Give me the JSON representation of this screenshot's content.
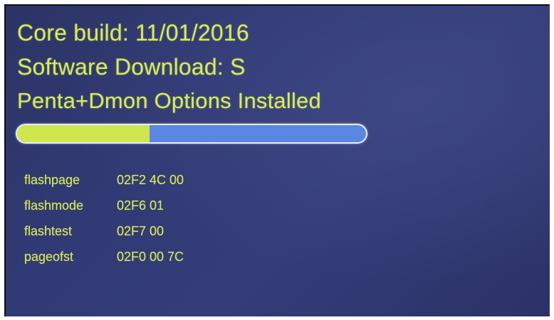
{
  "status": {
    "core_build": "Core build: 11/01/2016",
    "software_download": "Software Download: S",
    "options_installed": "Penta+Dmon Options Installed"
  },
  "progress": {
    "fraction": 0.38,
    "fill_color": "#cfe64c",
    "track_color": "#5a86e4"
  },
  "registers": [
    {
      "name": "flashpage",
      "value": "02F2 4C 00"
    },
    {
      "name": "flashmode",
      "value": "02F6 01"
    },
    {
      "name": "flashtest",
      "value": "02F7 00"
    },
    {
      "name": "pageofst",
      "value": "02F0 00 7C"
    }
  ],
  "colors": {
    "text": "#d7ec5a",
    "background": "#313a74"
  }
}
